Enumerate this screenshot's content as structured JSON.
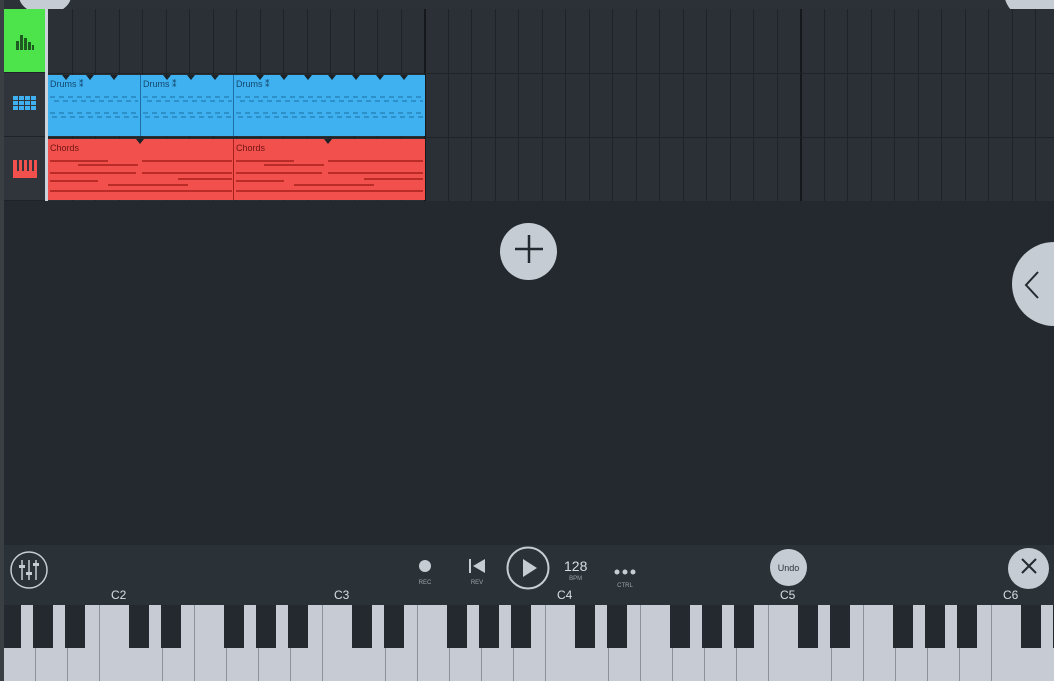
{
  "tracks": [
    {
      "name": "mixer-track",
      "icon": "mixer-bars-icon",
      "color": "#4de34a"
    },
    {
      "name": "drums-track",
      "icon": "step-grid-icon",
      "color": "#3fb1f0"
    },
    {
      "name": "chords-track",
      "icon": "piano-roll-icon",
      "color": "#f2504c"
    }
  ],
  "clips": {
    "drums": [
      "Drums ⁑",
      "Drums ⁑",
      "Drums ⁑"
    ],
    "chords": [
      "Chords",
      "Chords"
    ]
  },
  "toolbar": {
    "rec_label": "REC",
    "rev_label": "REV",
    "bpm_value": "128",
    "bpm_label": "BPM",
    "ctrl_label": "CTRL",
    "undo_label": "Undo"
  },
  "keyboard": {
    "octave_labels": [
      "C2",
      "C3",
      "C4",
      "C5",
      "C6"
    ]
  },
  "colors": {
    "background": "#23292e",
    "accent_green": "#4de34a",
    "drums_blue": "#3fb1f0",
    "chords_red": "#f2504c",
    "button_gray": "#c6ccd4"
  }
}
